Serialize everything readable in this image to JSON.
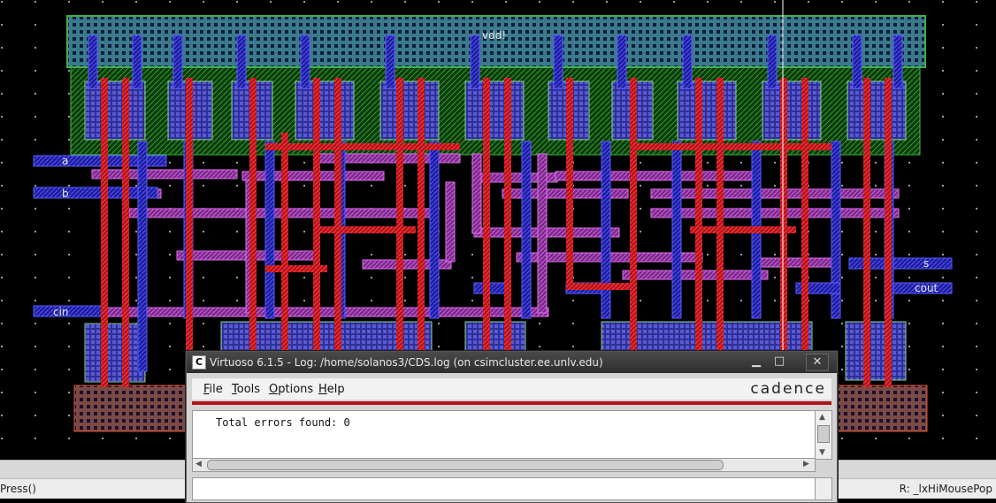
{
  "layout": {
    "pin_labels": {
      "vdd": "vdd!",
      "a": "a",
      "b": "b",
      "cin": "cin",
      "s": "s",
      "cout": "cout"
    },
    "colors": {
      "background": "#000000",
      "poly": "#e0201f",
      "metal1": "#2a2ae6",
      "metal2": "#c040c0",
      "nwell": "#2fa02f",
      "diffusion": "#6a6ad8",
      "substrate_tap": "#8a3a3a"
    }
  },
  "log_window": {
    "title": "Virtuoso 6.1.5 - Log: /home/solanos3/CDS.log (on csimcluster.ee.unlv.edu)",
    "app_icon": "C",
    "menu": {
      "file": "File",
      "tools": "Tools",
      "options": "Options",
      "help": "Help"
    },
    "brand": "cadence",
    "output_line": "Total errors found: 0",
    "input_value": "",
    "window_buttons": {
      "minimize": "minimize-icon",
      "maximize": "maximize-icon",
      "close": "close-icon"
    }
  },
  "status_bar": {
    "left": "Press()",
    "right": "R: _lxHiMousePop"
  }
}
